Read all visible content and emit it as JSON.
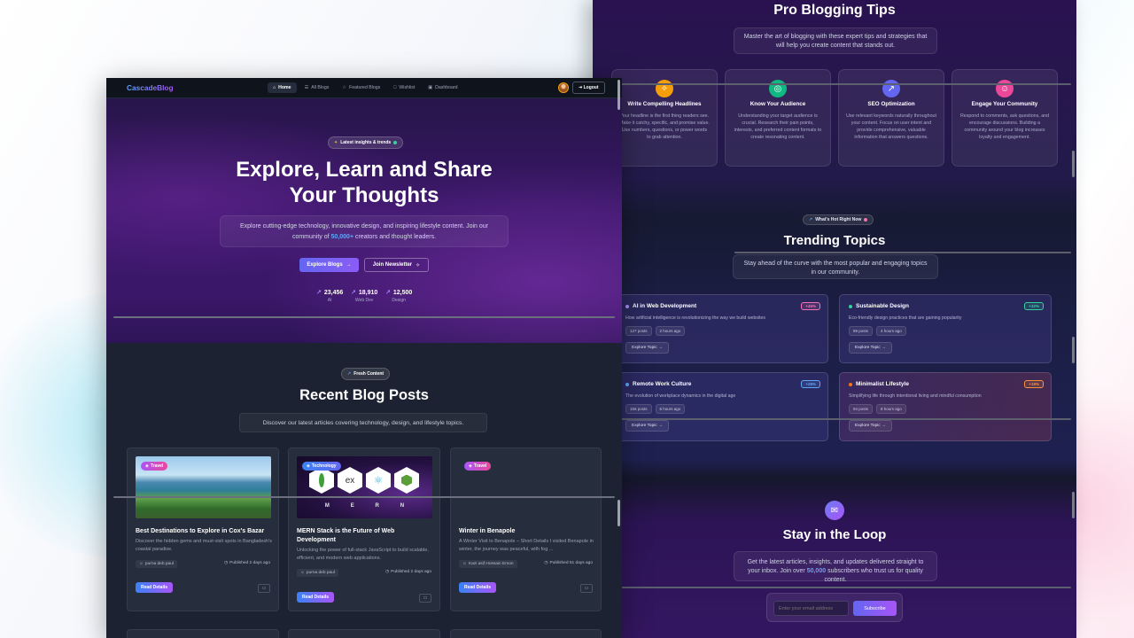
{
  "right": {
    "tips_title": "Pro Blogging Tips",
    "tips_sub": "Master the art of blogging with these expert tips and strategies that will help you create content that stands out.",
    "tips": [
      {
        "title": "Write Compelling Headlines",
        "icon": "lightbulb-icon",
        "glyph": "✧",
        "color": "#f59e0b",
        "body": "Your headline is the first thing readers see. Make it catchy, specific, and promise value. Use numbers, questions, or power words to grab attention."
      },
      {
        "title": "Know Your Audience",
        "icon": "target-icon",
        "glyph": "◎",
        "color": "#10b981",
        "body": "Understanding your target audience is crucial. Research their pain points, interests, and preferred content formats to create resonating content."
      },
      {
        "title": "SEO Optimization",
        "icon": "trend-icon",
        "glyph": "↗",
        "color": "#6366f1",
        "body": "Use relevant keywords naturally throughout your content. Focus on user intent and provide comprehensive, valuable information that answers questions."
      },
      {
        "title": "Engage Your Community",
        "icon": "users-icon",
        "glyph": "☺",
        "color": "#ec4899",
        "body": "Respond to comments, ask questions, and encourage discussions. Building a community around your blog increases loyalty and engagement."
      }
    ],
    "hot_pill": "What's Hot Right Now",
    "trending_title": "Trending Topics",
    "trending_sub": "Stay ahead of the curve with the most popular and engaging topics in our community.",
    "topics": [
      {
        "name": "AI in Web Development",
        "badge": "+45%",
        "badge_color": "#f472b6",
        "dot": "#a78bfa",
        "desc": "How artificial intelligence is revolutionizing the way we build websites",
        "posts": "127 posts",
        "time": "2 hours ago",
        "btn": "Explore Topic"
      },
      {
        "name": "Sustainable Design",
        "badge": "+32%",
        "badge_color": "#34d399",
        "dot": "#34d399",
        "desc": "Eco-friendly design practices that are gaining popularity",
        "posts": "89 posts",
        "time": "4 hours ago",
        "btn": "Explore Topic"
      },
      {
        "name": "Remote Work Culture",
        "badge": "+28%",
        "badge_color": "#60a5fa",
        "dot": "#60a5fa",
        "desc": "The evolution of workplace dynamics in the digital age",
        "posts": "156 posts",
        "time": "6 hours ago",
        "btn": "Explore Topic"
      },
      {
        "name": "Minimalist Lifestyle",
        "badge": "+19%",
        "badge_color": "#fb923c",
        "dot": "#f97316",
        "desc": "Simplifying life through intentional living and mindful consumption",
        "posts": "94 posts",
        "time": "8 hours ago",
        "btn": "Explore Topic"
      }
    ],
    "loop_title": "Stay in the Loop",
    "loop_sub_a": "Get the latest articles, insights, and updates delivered straight to your inbox. Join over ",
    "loop_sub_hl": "50,000",
    "loop_sub_b": " subscribers who trust us for quality content.",
    "email_placeholder": "Enter your email address",
    "subscribe": "Subscribe"
  },
  "left": {
    "logo": "CascadeBlog",
    "nav": [
      {
        "label": "Home",
        "icon": "home-icon",
        "glyph": "⌂",
        "active": true
      },
      {
        "label": "All Blogs",
        "icon": "document-icon",
        "glyph": "☰",
        "active": false
      },
      {
        "label": "Featured Blogs",
        "icon": "star-icon",
        "glyph": "☆",
        "active": false
      },
      {
        "label": "Wishlist",
        "icon": "bookmark-icon",
        "glyph": "□",
        "active": false
      },
      {
        "label": "Dashboard",
        "icon": "dashboard-icon",
        "glyph": "▣",
        "active": false
      }
    ],
    "logout": "Logout",
    "hero_pill": "Latest insights & trends",
    "hero_title_1": "Explore, Learn and Share",
    "hero_title_2": "Your Thoughts",
    "hero_sub_a": "Explore cutting-edge technology, innovative design, and inspiring lifestyle content. Join our community of ",
    "hero_sub_hl": "50,000+",
    "hero_sub_b": " creators and thought leaders.",
    "btn_explore": "Explore Blogs",
    "btn_news": "Join Newsletter",
    "stats": [
      {
        "value": "23,456",
        "label": "AI"
      },
      {
        "value": "18,910",
        "label": "Web Dev"
      },
      {
        "value": "12,500",
        "label": "Design"
      }
    ],
    "fresh_pill": "Fresh Content",
    "recent_title": "Recent Blog Posts",
    "recent_sub": "Discover our latest articles covering technology, design, and lifestyle topics.",
    "posts": [
      {
        "tag": "Travel",
        "title": "Best Destinations to Explore in Cox's Bazar",
        "desc": "Discover the hidden gems and must-visit spots in Bangladesh's coastal paradise.",
        "author": "purna deb paul",
        "published": "Published 2 days ago",
        "read": "Read Details"
      },
      {
        "tag": "Technology",
        "title": "MERN Stack is the Future of Web Development",
        "desc": "Unlocking the power of full-stack JavaScript to build scalable, efficient, and modern web applications.",
        "author": "purna deb paul",
        "published": "Published 2 days ago",
        "read": "Read Details"
      },
      {
        "tag": "Travel",
        "title": "Winter in Benapole",
        "desc": "A Winter Visit to Benapole – Short Details I visited Benapole in winter, the journey was peaceful, with fog ...",
        "author": "Kazi asif Hossain Emon",
        "published": "Published 51 days ago",
        "read": "Read Details"
      }
    ],
    "mern_letters": [
      "M",
      "E",
      "R",
      "N"
    ],
    "mern_logo_ex": "ex"
  }
}
